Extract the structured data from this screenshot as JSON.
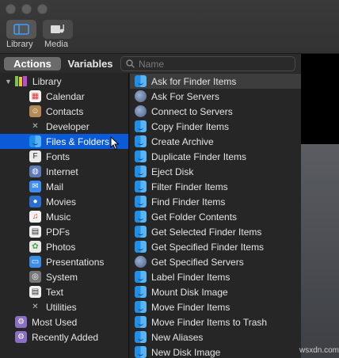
{
  "toolbar": {
    "library_label": "Library",
    "media_label": "Media"
  },
  "tabs": {
    "actions": "Actions",
    "variables": "Variables"
  },
  "search": {
    "placeholder": "Name"
  },
  "library_tree": {
    "root": "Library",
    "items": [
      {
        "label": "Calendar",
        "icon": "calendar-icon"
      },
      {
        "label": "Contacts",
        "icon": "contacts-icon"
      },
      {
        "label": "Developer",
        "icon": "developer-icon"
      },
      {
        "label": "Files & Folders",
        "icon": "finder-icon",
        "selected": true
      },
      {
        "label": "Fonts",
        "icon": "fonts-icon"
      },
      {
        "label": "Internet",
        "icon": "internet-icon"
      },
      {
        "label": "Mail",
        "icon": "mail-icon"
      },
      {
        "label": "Movies",
        "icon": "movies-icon"
      },
      {
        "label": "Music",
        "icon": "music-icon"
      },
      {
        "label": "PDFs",
        "icon": "pdf-icon"
      },
      {
        "label": "Photos",
        "icon": "photos-icon"
      },
      {
        "label": "Presentations",
        "icon": "presentations-icon"
      },
      {
        "label": "System",
        "icon": "system-icon"
      },
      {
        "label": "Text",
        "icon": "text-icon"
      },
      {
        "label": "Utilities",
        "icon": "utilities-icon"
      }
    ],
    "most_used": "Most Used",
    "recently_added": "Recently Added"
  },
  "actions": [
    {
      "label": "Ask for Finder Items",
      "icon": "finder-icon"
    },
    {
      "label": "Ask For Servers",
      "icon": "server-icon"
    },
    {
      "label": "Connect to Servers",
      "icon": "server-icon"
    },
    {
      "label": "Copy Finder Items",
      "icon": "finder-icon"
    },
    {
      "label": "Create Archive",
      "icon": "finder-icon"
    },
    {
      "label": "Duplicate Finder Items",
      "icon": "finder-icon"
    },
    {
      "label": "Eject Disk",
      "icon": "finder-icon"
    },
    {
      "label": "Filter Finder Items",
      "icon": "finder-icon"
    },
    {
      "label": "Find Finder Items",
      "icon": "finder-icon"
    },
    {
      "label": "Get Folder Contents",
      "icon": "finder-icon"
    },
    {
      "label": "Get Selected Finder Items",
      "icon": "finder-icon"
    },
    {
      "label": "Get Specified Finder Items",
      "icon": "finder-icon"
    },
    {
      "label": "Get Specified Servers",
      "icon": "server-icon"
    },
    {
      "label": "Label Finder Items",
      "icon": "finder-icon"
    },
    {
      "label": "Mount Disk Image",
      "icon": "finder-icon"
    },
    {
      "label": "Move Finder Items",
      "icon": "finder-icon"
    },
    {
      "label": "Move Finder Items to Trash",
      "icon": "finder-icon"
    },
    {
      "label": "New Aliases",
      "icon": "finder-icon"
    },
    {
      "label": "New Disk Image",
      "icon": "finder-icon"
    }
  ],
  "watermark": "wsxdn.com",
  "colors": {
    "selection": "#0b5bd8",
    "panel_bg": "#262626"
  }
}
